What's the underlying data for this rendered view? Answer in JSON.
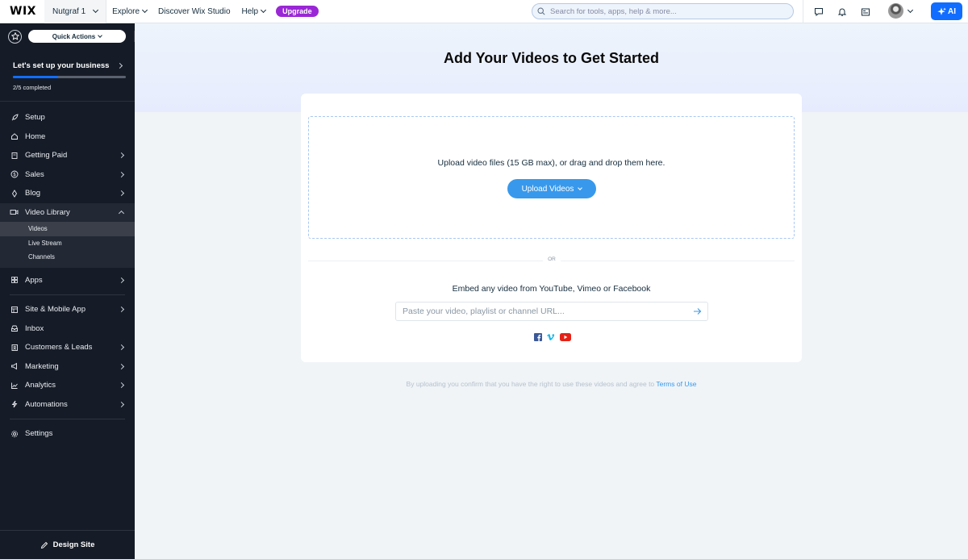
{
  "topbar": {
    "logo": "WIX",
    "site_name": "Nutgraf 1",
    "nav": [
      {
        "label": "Explore",
        "has_dropdown": true
      },
      {
        "label": "Discover Wix Studio",
        "has_dropdown": false
      },
      {
        "label": "Help",
        "has_dropdown": true
      }
    ],
    "upgrade_label": "Upgrade",
    "search_placeholder": "Search for tools, apps, help & more...",
    "icons": [
      "chat-icon",
      "bell-icon",
      "newspaper-icon"
    ],
    "ai_label": "AI"
  },
  "sidebar": {
    "quick_actions_label": "Quick Actions",
    "setup_title": "Let's set up your business",
    "progress_fraction": 0.4,
    "progress_label": "2/5 completed",
    "items": [
      {
        "label": "Setup",
        "icon": "rocket-icon"
      },
      {
        "label": "Home",
        "icon": "home-icon"
      },
      {
        "label": "Getting Paid",
        "icon": "receipt-icon"
      },
      {
        "label": "Sales",
        "icon": "dollar-icon"
      },
      {
        "label": "Blog",
        "icon": "pen-nib-icon"
      },
      {
        "label": "Video Library",
        "icon": "video-icon"
      },
      {
        "label": "Apps",
        "icon": "apps-icon"
      },
      {
        "label": "Site & Mobile App",
        "icon": "layout-icon"
      },
      {
        "label": "Inbox",
        "icon": "inbox-icon"
      },
      {
        "label": "Customers & Leads",
        "icon": "contacts-icon"
      },
      {
        "label": "Marketing",
        "icon": "megaphone-icon"
      },
      {
        "label": "Analytics",
        "icon": "chart-icon"
      },
      {
        "label": "Automations",
        "icon": "bolt-icon"
      },
      {
        "label": "Settings",
        "icon": "gear-icon"
      }
    ],
    "sub_items": [
      "Videos",
      "Live Stream",
      "Channels"
    ],
    "design_site_label": "Design Site"
  },
  "main": {
    "title": "Add Your Videos to Get Started",
    "upload_text": "Upload video files (15 GB max), or drag and drop them here.",
    "upload_button": "Upload Videos",
    "or_text": "OR",
    "embed_text": "Embed any video from YouTube, Vimeo or Facebook",
    "url_placeholder": "Paste your video, playlist or channel URL...",
    "disclaimer": "By uploading you confirm that you have the right to use these videos and agree to ",
    "terms_link": "Terms of Use",
    "colors": {
      "accent": "#3899ec",
      "facebook": "#3b5998",
      "vimeo": "#1ab7ea",
      "youtube": "#e62117"
    }
  }
}
